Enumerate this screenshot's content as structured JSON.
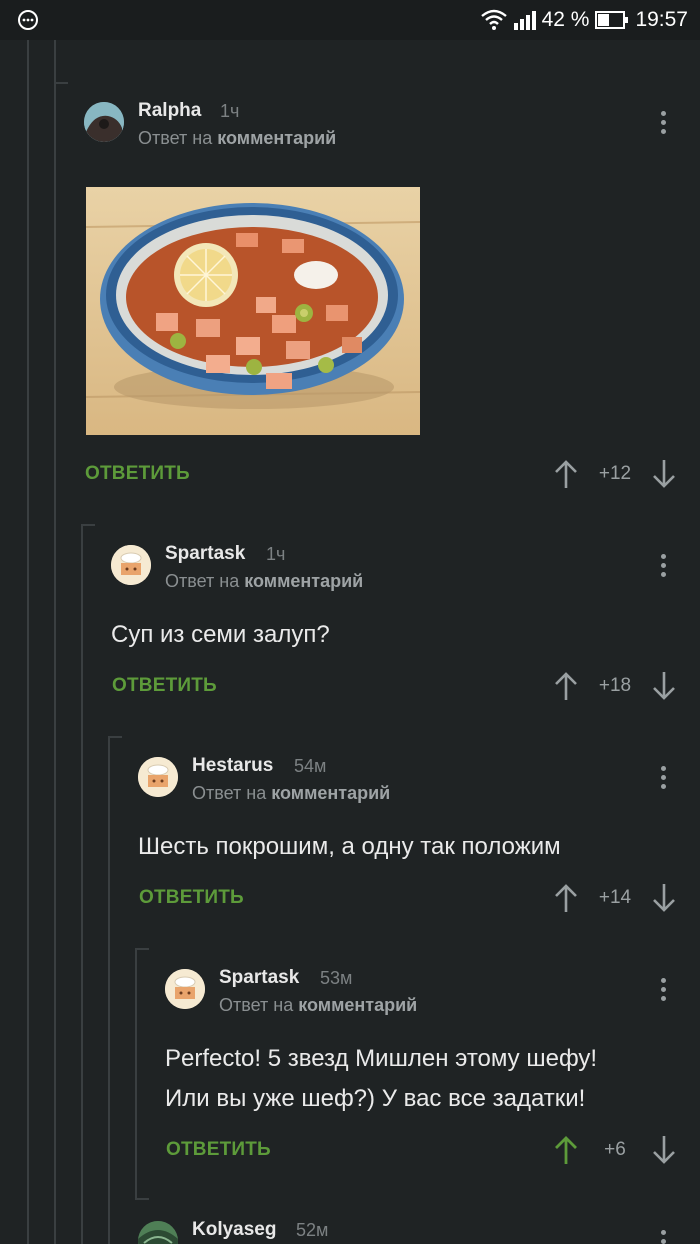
{
  "status_bar": {
    "battery": "42 %",
    "time": "19:57"
  },
  "reply_label": "ОТВЕТИТЬ",
  "reply_to_prefix": "Ответ на",
  "reply_to_target": "комментарий",
  "comments": [
    {
      "author": "Ralpha",
      "time": "1ч",
      "image": "solyanka-soup-photo",
      "score": "+12",
      "upvoted": false
    },
    {
      "author": "Spartask",
      "time": "1ч",
      "text": "Суп из семи залуп?",
      "score": "+18",
      "upvoted": false
    },
    {
      "author": "Hestarus",
      "time": "54м",
      "text": "Шесть покрошим, а одну так положим",
      "score": "+14",
      "upvoted": false
    },
    {
      "author": "Spartask",
      "time": "53м",
      "text_lines": [
        "Perfecto! 5 звезд Мишлен этому шефу!",
        "Или вы уже шеф?) У вас все задатки!"
      ],
      "score": "+6",
      "upvoted": true
    },
    {
      "author": "Kolyaseg",
      "time": "52м"
    }
  ],
  "colors": {
    "background": "#1f2324",
    "accent_green": "#5d9b3a",
    "thread_line": "#3a3f41"
  }
}
